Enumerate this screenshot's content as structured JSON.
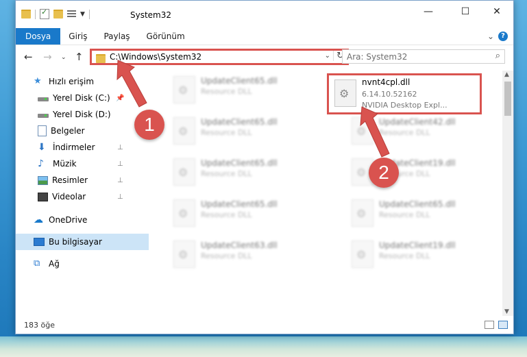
{
  "window": {
    "title": "System32"
  },
  "ribbon": {
    "tabs": [
      "Dosya",
      "Giriş",
      "Paylaş",
      "Görünüm"
    ]
  },
  "nav": {
    "address": "C:\\Windows\\System32",
    "search_placeholder": "Ara: System32"
  },
  "sidebar": {
    "items": [
      {
        "label": "Hızlı erişim",
        "icon": "star-icon"
      },
      {
        "label": "Yerel Disk (C:)",
        "icon": "drive-icon"
      },
      {
        "label": "Yerel Disk (D:)",
        "icon": "drive-icon"
      },
      {
        "label": "Belgeler",
        "icon": "documents-icon"
      },
      {
        "label": "İndirmeler",
        "icon": "downloads-icon"
      },
      {
        "label": "Müzik",
        "icon": "music-icon"
      },
      {
        "label": "Resimler",
        "icon": "pictures-icon"
      },
      {
        "label": "Videolar",
        "icon": "videos-icon"
      },
      {
        "label": "OneDrive",
        "icon": "cloud-icon"
      },
      {
        "label": "Bu bilgisayar",
        "icon": "computer-icon"
      },
      {
        "label": "Ağ",
        "icon": "network-icon"
      }
    ]
  },
  "files": {
    "highlighted": {
      "name": "nvnt4cpl.dll",
      "version": "6.14.10.52162",
      "desc": "NVIDIA Desktop Expl..."
    },
    "left": [
      {
        "name": "UpdateClient65.dll",
        "desc": "Resource DLL"
      },
      {
        "name": "UpdateClient65.dll",
        "desc": "Resource DLL"
      },
      {
        "name": "UpdateClient65.dll",
        "desc": "Resource DLL"
      },
      {
        "name": "UpdateClient65.dll",
        "desc": "Resource DLL"
      },
      {
        "name": "UpdateClient63.dll",
        "desc": "Resource DLL"
      }
    ],
    "right": [
      {
        "name": "UpdateClient42.dll",
        "desc": "Resource DLL"
      },
      {
        "name": "UpdateClient19.dll",
        "desc": "Resource DLL"
      },
      {
        "name": "UpdateClient65.dll",
        "desc": "Resource DLL"
      },
      {
        "name": "UpdateClient19.dll",
        "desc": "Resource DLL"
      }
    ]
  },
  "status": {
    "count": "183 öğe"
  },
  "annotations": {
    "step1": "1",
    "step2": "2",
    "color": "#d9534f"
  }
}
